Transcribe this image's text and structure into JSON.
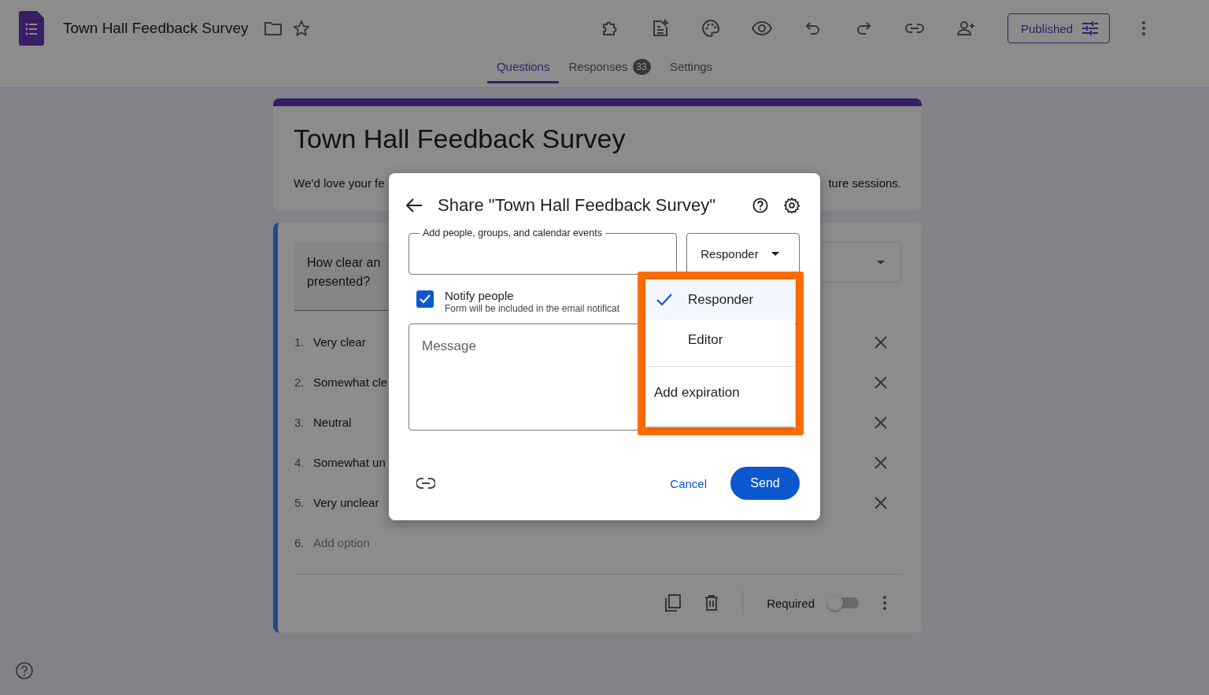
{
  "app_bar": {
    "title": "Town Hall Feedback Survey",
    "publish_button": "Published"
  },
  "tabs": [
    {
      "label": "Questions",
      "selected": true
    },
    {
      "label": "Responses",
      "selected": false,
      "badge": "33"
    },
    {
      "label": "Settings",
      "selected": false
    }
  ],
  "form": {
    "title": "Town Hall Feedback Survey",
    "description_start": "We’d love your fe",
    "description_end": "ture sessions.",
    "question": {
      "text_lines": [
        "How clear an",
        "presented?"
      ],
      "options": [
        {
          "number": "1.",
          "label": "Very clear",
          "kind": "option"
        },
        {
          "number": "2.",
          "label": "Somewhat cle",
          "kind": "option"
        },
        {
          "number": "3.",
          "label": "Neutral",
          "kind": "option"
        },
        {
          "number": "4.",
          "label": "Somewhat un",
          "kind": "option"
        },
        {
          "number": "5.",
          "label": "Very unclear",
          "kind": "option"
        },
        {
          "number": "6.",
          "label": "Add option",
          "kind": "add"
        }
      ],
      "required_label": "Required",
      "required": false
    }
  },
  "share_dialog": {
    "title": "Share \"Town Hall Feedback Survey\"",
    "people_field_label": "Add people, groups, and calendar events",
    "role_select": "Responder",
    "notify": {
      "label": "Notify people",
      "hint": "Form will be included in the email notificat",
      "checked": true
    },
    "message_placeholder": "Message",
    "cancel": "Cancel",
    "send": "Send",
    "role_menu": {
      "items": [
        {
          "label": "Responder",
          "selected": true
        },
        {
          "label": "Editor",
          "selected": false
        }
      ],
      "extra_item": "Add expiration",
      "highlighted": true
    }
  }
}
